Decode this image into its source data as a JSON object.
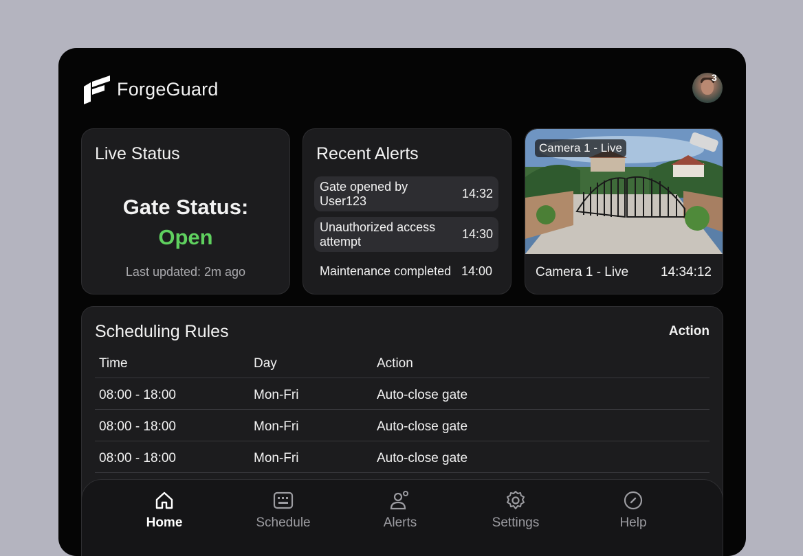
{
  "app": {
    "name": "ForgeGuard",
    "notification_count": "3"
  },
  "live_status": {
    "title": "Live Status",
    "gate_label": "Gate Status:",
    "gate_value": "Open",
    "last_updated": "Last updated: 2m ago",
    "status_color": "#5fd15f"
  },
  "recent_alerts": {
    "title": "Recent Alerts",
    "items": [
      {
        "text": "Gate opened by User123",
        "time": "14:32"
      },
      {
        "text": "Unauthorized access attempt",
        "time": "14:30"
      },
      {
        "text": "Maintenance completed",
        "time": "14:00"
      }
    ]
  },
  "camera": {
    "overlay_label": "Camera 1 - Live",
    "name": "Camera 1 - Live",
    "timestamp": "14:34:12"
  },
  "scheduling": {
    "title": "Scheduling Rules",
    "action_label": "Action",
    "columns": [
      "Time",
      "Day",
      "Action"
    ],
    "rows": [
      {
        "time": "08:00 - 18:00",
        "day": "Mon-Fri",
        "action": "Auto-close gate"
      },
      {
        "time": "08:00 - 18:00",
        "day": "Mon-Fri",
        "action": "Auto-close gate"
      },
      {
        "time": "08:00 - 18:00",
        "day": "Mon-Fri",
        "action": "Auto-close gate"
      }
    ]
  },
  "nav": {
    "items": [
      {
        "label": "Home",
        "icon": "home-icon",
        "active": true
      },
      {
        "label": "Schedule",
        "icon": "keyboard-icon"
      },
      {
        "label": "Alerts",
        "icon": "people-icon"
      },
      {
        "label": "Settings",
        "icon": "gear-icon"
      },
      {
        "label": "Help",
        "icon": "compass-icon"
      }
    ]
  }
}
